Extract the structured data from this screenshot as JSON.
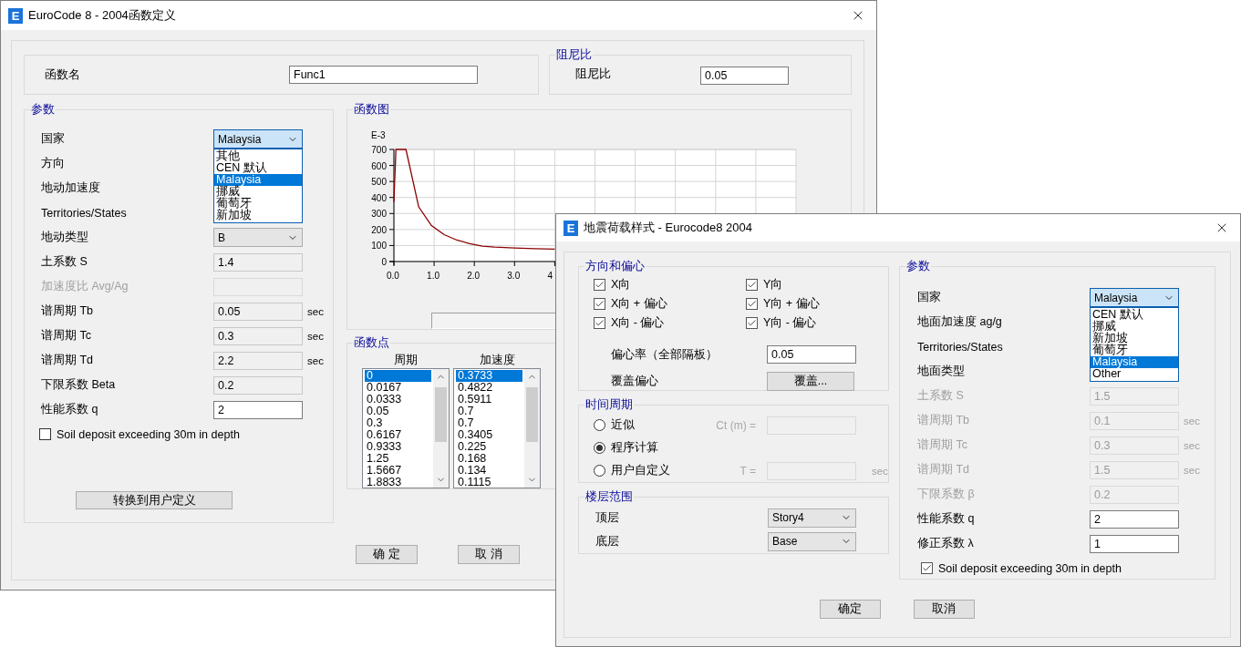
{
  "function_dialog": {
    "icon_letter": "E",
    "title": "EuroCode 8 - 2004函数定义",
    "name_label": "函数名",
    "name_value": "Func1",
    "damping": {
      "title": "阻尼比",
      "label": "阻尼比",
      "value": "0.05"
    },
    "params": {
      "title": "参数",
      "rows": [
        {
          "label": "国家",
          "kind": "combo",
          "disabled": false,
          "value": "Malaysia",
          "open": true,
          "options": [
            {
              "label": "其他",
              "selected": false
            },
            {
              "label": "CEN 默认",
              "selected": false
            },
            {
              "label": "Malaysia",
              "selected": true
            },
            {
              "label": "挪威",
              "selected": false
            },
            {
              "label": "葡萄牙",
              "selected": false
            },
            {
              "label": "新加坡",
              "selected": false
            }
          ]
        },
        {
          "label": "方向",
          "kind": "none",
          "disabled": false
        },
        {
          "label": "地动加速度",
          "kind": "none",
          "disabled": false
        },
        {
          "label": "Territories/States",
          "kind": "none",
          "disabled": false
        },
        {
          "label": "地动类型",
          "kind": "combo",
          "disabled": false,
          "value": "B",
          "open": false
        },
        {
          "label": "土系数 S",
          "kind": "readonly",
          "disabled": false,
          "value": "1.4"
        },
        {
          "label": "加速度比 Avg/Ag",
          "kind": "readonly",
          "disabled": true
        },
        {
          "label": "谱周期 Tb",
          "kind": "readonly",
          "disabled": false,
          "value": "0.05",
          "unit": "sec"
        },
        {
          "label": "谱周期 Tc",
          "kind": "readonly",
          "disabled": false,
          "value": "0.3",
          "unit": "sec"
        },
        {
          "label": "谱周期 Td",
          "kind": "readonly",
          "disabled": false,
          "value": "2.2",
          "unit": "sec"
        },
        {
          "label": "下限系数 Beta",
          "kind": "readonly",
          "disabled": false,
          "value": "0.2"
        },
        {
          "label": "性能系数 q",
          "kind": "input",
          "disabled": false,
          "value": "2"
        }
      ],
      "checkbox": {
        "label": "Soil deposit exceeding 30m in depth",
        "checked": false
      },
      "convert_button": "转换到用户定义"
    },
    "chart": {
      "title": "函数图",
      "unit_label": "E-3",
      "chart_data": {
        "type": "line",
        "xlim": [
          0,
          10
        ],
        "ylim": [
          0,
          700
        ],
        "xticks": [
          {
            "value": 0,
            "label": "0.0"
          },
          {
            "value": 1,
            "label": "1.0"
          },
          {
            "value": 2,
            "label": "2.0"
          },
          {
            "value": 3,
            "label": "3.0"
          },
          {
            "value": 4,
            "label": "4"
          }
        ],
        "yticks": [
          0,
          100,
          200,
          300,
          400,
          500,
          600,
          700
        ],
        "grid": true,
        "series": [
          {
            "color": "#8b0000",
            "x": [
              0,
              0.0167,
              0.0333,
              0.05,
              0.3,
              0.6167,
              0.9333,
              1.25,
              1.5667,
              1.8833,
              2.2,
              2.5,
              3.0,
              3.5,
              4.0
            ],
            "values": [
              373,
              482,
              591,
              700,
              700,
              341,
              225,
              168,
              134,
              112,
              96,
              90,
              85,
              80,
              78
            ]
          }
        ]
      }
    },
    "points": {
      "title": "函数点",
      "columns": [
        {
          "header": "周期",
          "items": [
            {
              "text": "0",
              "selected": true
            },
            {
              "text": "0.0167",
              "selected": false
            },
            {
              "text": "0.0333",
              "selected": false
            },
            {
              "text": "0.05",
              "selected": false
            },
            {
              "text": "0.3",
              "selected": false
            },
            {
              "text": "0.6167",
              "selected": false
            },
            {
              "text": "0.9333",
              "selected": false
            },
            {
              "text": "1.25",
              "selected": false
            },
            {
              "text": "1.5667",
              "selected": false
            },
            {
              "text": "1.8833",
              "selected": false
            }
          ]
        },
        {
          "header": "加速度",
          "items": [
            {
              "text": "0.3733",
              "selected": true
            },
            {
              "text": "0.4822",
              "selected": false
            },
            {
              "text": "0.5911",
              "selected": false
            },
            {
              "text": "0.7",
              "selected": false
            },
            {
              "text": "0.7",
              "selected": false
            },
            {
              "text": "0.3405",
              "selected": false
            },
            {
              "text": "0.225",
              "selected": false
            },
            {
              "text": "0.168",
              "selected": false
            },
            {
              "text": "0.134",
              "selected": false
            },
            {
              "text": "0.1115",
              "selected": false
            }
          ]
        }
      ]
    },
    "buttons": [
      "确 定",
      "取 消"
    ]
  },
  "load_pattern_dialog": {
    "icon_letter": "E",
    "title": "地震荷载样式 - Eurocode8 2004",
    "direction": {
      "title": "方向和偏心",
      "checks": [
        {
          "label": "X向",
          "checked": true
        },
        {
          "label": "Y向",
          "checked": true
        },
        {
          "label": "X向 + 偏心",
          "checked": true
        },
        {
          "label": "Y向 + 偏心",
          "checked": true
        },
        {
          "label": "X向 - 偏心",
          "checked": true
        },
        {
          "label": "Y向 - 偏心",
          "checked": true
        }
      ],
      "eccentricity_label": "偏心率（全部隔板）",
      "eccentricity_value": "0.05",
      "override_label": "覆盖偏心",
      "override_button": "覆盖..."
    },
    "period": {
      "title": "时间周期",
      "options": [
        {
          "label": "近似",
          "selected": false,
          "field_label": "Ct (m) ="
        },
        {
          "label": "程序计算",
          "selected": true
        },
        {
          "label": "用户自定义",
          "selected": false,
          "field_label": "T =",
          "unit": "sec"
        }
      ]
    },
    "stories": {
      "title": "楼层范围",
      "rows": [
        {
          "label": "顶层",
          "value": "Story4"
        },
        {
          "label": "底层",
          "value": "Base"
        }
      ]
    },
    "params": {
      "title": "参数",
      "rows": [
        {
          "label": "国家",
          "kind": "combo",
          "disabled": false,
          "value": "Malaysia",
          "open": true,
          "options": [
            {
              "label": "CEN 默认",
              "selected": false
            },
            {
              "label": "挪威",
              "selected": false
            },
            {
              "label": "新加坡",
              "selected": false
            },
            {
              "label": "葡萄牙",
              "selected": false
            },
            {
              "label": "Malaysia",
              "selected": true
            },
            {
              "label": "Other",
              "selected": false
            }
          ]
        },
        {
          "label": "地面加速度 ag/g",
          "kind": "none",
          "disabled": false
        },
        {
          "label": "Territories/States",
          "kind": "none",
          "disabled": false
        },
        {
          "label": "地面类型",
          "kind": "none",
          "disabled": false
        },
        {
          "label": "土系数 S",
          "kind": "readonly",
          "disabled": true,
          "value": "1.5"
        },
        {
          "label": "谱周期 Tb",
          "kind": "readonly",
          "disabled": true,
          "value": "0.1",
          "unit": "sec"
        },
        {
          "label": "谱周期 Tc",
          "kind": "readonly",
          "disabled": true,
          "value": "0.3",
          "unit": "sec"
        },
        {
          "label": "谱周期 Td",
          "kind": "readonly",
          "disabled": true,
          "value": "1.5",
          "unit": "sec"
        },
        {
          "label": "下限系数 β",
          "kind": "readonly",
          "disabled": true,
          "value": "0.2"
        },
        {
          "label": "性能系数 q",
          "kind": "input",
          "disabled": false,
          "value": "2"
        },
        {
          "label": "修正系数 λ",
          "kind": "input",
          "disabled": false,
          "value": "1"
        }
      ],
      "checkbox": {
        "label": "Soil deposit exceeding 30m in depth",
        "checked": true
      }
    },
    "buttons": [
      "确定",
      "取消"
    ]
  }
}
